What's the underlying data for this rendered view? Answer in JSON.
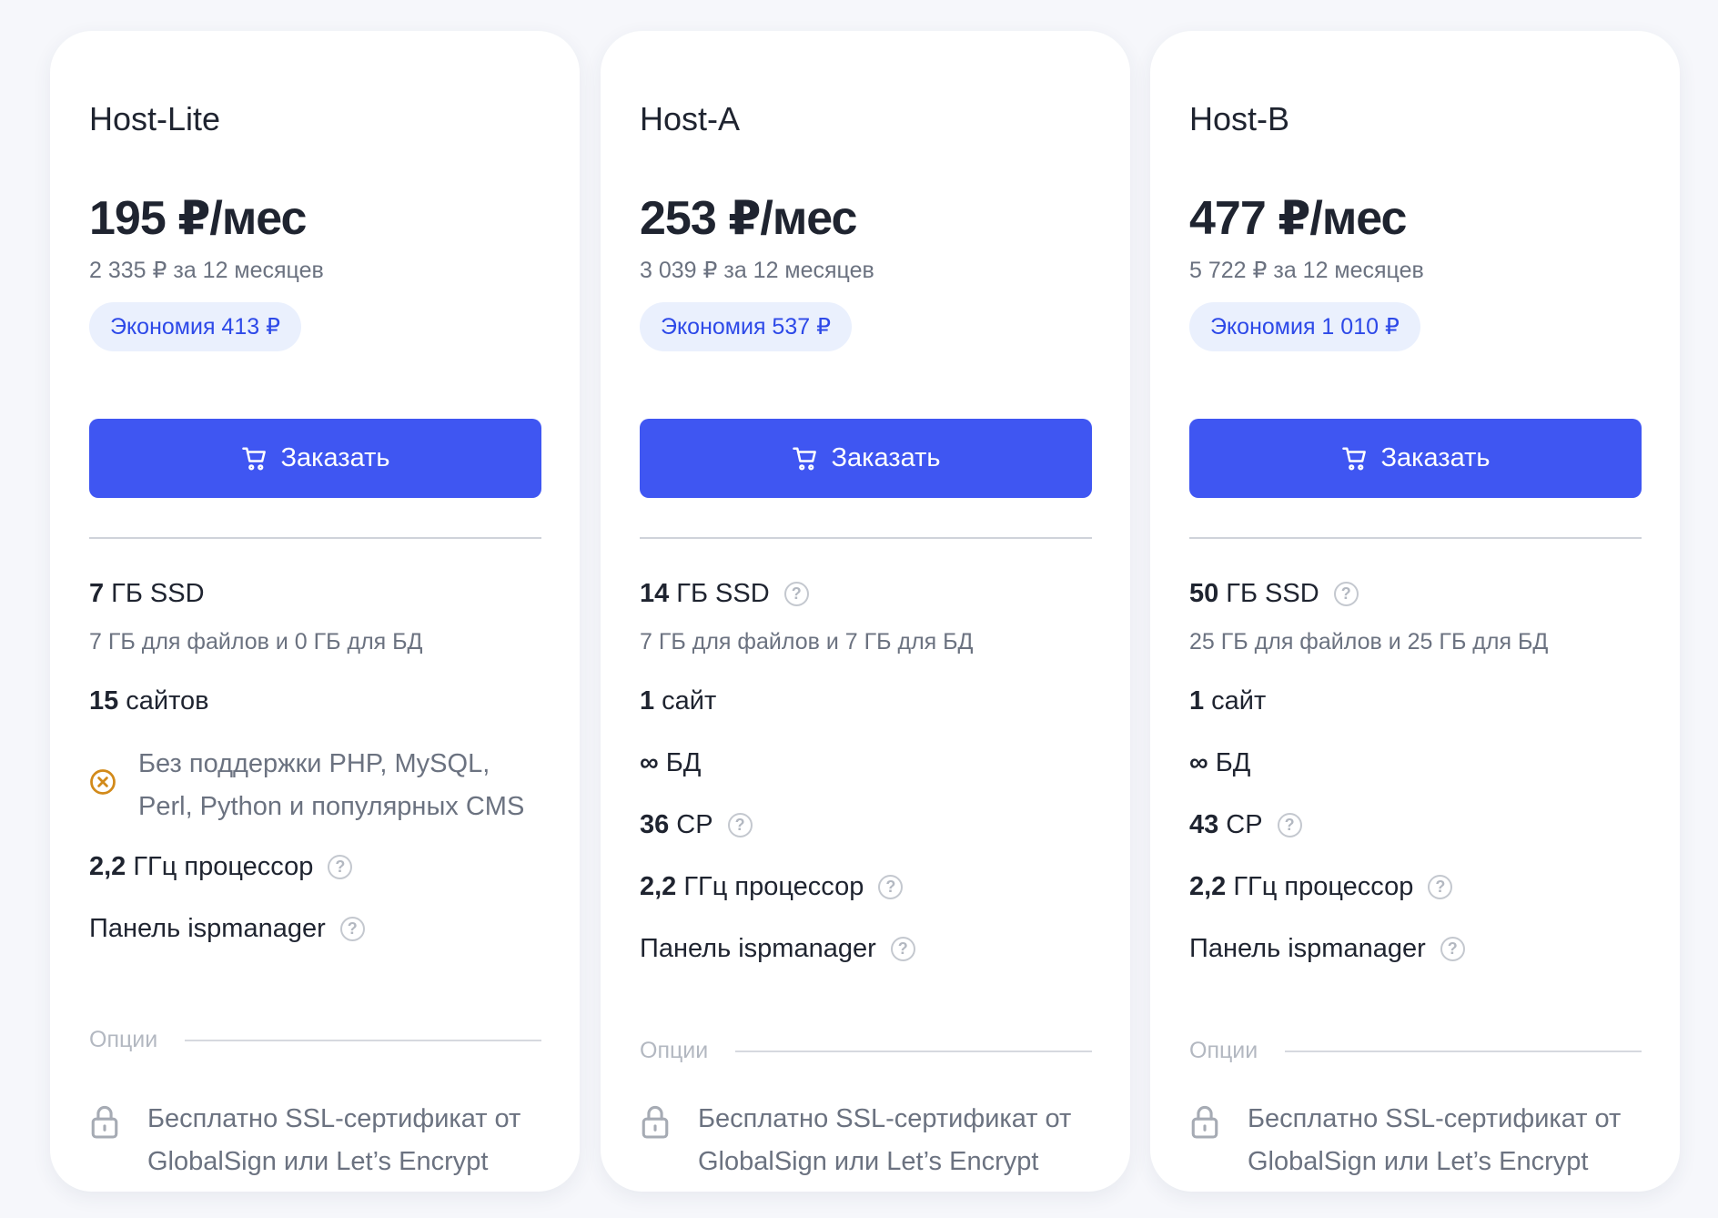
{
  "order_label": "Заказать",
  "options_label": "Опции",
  "help_glyph": "?",
  "ssl_text": "Бесплатно SSL-сертификат от GlobalSign или Let’s Encrypt",
  "colors": {
    "accent": "#3f56f2",
    "badge_bg": "#eaf0fd",
    "badge_text": "#2d49e8",
    "warning": "#d28a1a"
  },
  "icons": {
    "cart": "cart-icon",
    "help": "question-circle-icon",
    "warning": "x-circle-icon",
    "lock": "lock-icon"
  },
  "plans": [
    {
      "name": "Host-Lite",
      "price": "195 ₽/мес",
      "year_price": "2 335 ₽ за 12 месяцев",
      "savings": "Экономия 413 ₽",
      "ssd_value": "7",
      "ssd_label": "ГБ SSD",
      "ssd_detail": "7 ГБ для файлов и 0 ГБ для БД",
      "sites_value": "15",
      "sites_label": "сайтов",
      "warning": "Без поддержки PHP, MySQL, Perl, Python и популярных CMS",
      "cpu_value": "2,2",
      "cpu_label": "ГГц процессор",
      "panel": "Панель ispmanager"
    },
    {
      "name": "Host-A",
      "price": "253 ₽/мес",
      "year_price": "3 039 ₽ за 12 месяцев",
      "savings": "Экономия 537 ₽",
      "ssd_value": "14",
      "ssd_label": "ГБ SSD",
      "ssd_detail": "7 ГБ для файлов и 7 ГБ для БД",
      "sites_value": "1",
      "sites_label": "сайт",
      "db_value": "∞",
      "db_label": "БД",
      "cp_value": "36",
      "cp_label": "CP",
      "cpu_value": "2,2",
      "cpu_label": "ГГц процессор",
      "panel": "Панель ispmanager"
    },
    {
      "name": "Host-B",
      "price": "477 ₽/мес",
      "year_price": "5 722 ₽ за 12 месяцев",
      "savings": "Экономия 1 010 ₽",
      "ssd_value": "50",
      "ssd_label": "ГБ SSD",
      "ssd_detail": "25 ГБ для файлов и 25 ГБ для БД",
      "sites_value": "1",
      "sites_label": "сайт",
      "db_value": "∞",
      "db_label": "БД",
      "cp_value": "43",
      "cp_label": "CP",
      "cpu_value": "2,2",
      "cpu_label": "ГГц процессор",
      "panel": "Панель ispmanager"
    }
  ]
}
